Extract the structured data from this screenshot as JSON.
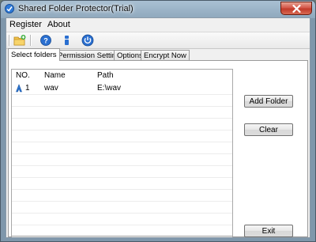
{
  "window": {
    "title": "Shared Folder Protector(Trial)"
  },
  "menu": [
    {
      "label": "Register"
    },
    {
      "label": "About"
    }
  ],
  "toolbar": {
    "icons": [
      "folder-add-icon",
      "help-icon",
      "info-icon",
      "power-icon"
    ]
  },
  "tabs": [
    {
      "label": "Select folders",
      "active": true
    },
    {
      "label": "Permission Settings",
      "active": false
    },
    {
      "label": "Options",
      "active": false
    },
    {
      "label": "Encrypt Now",
      "active": false
    }
  ],
  "table": {
    "columns": [
      "NO.",
      "Name",
      "Path"
    ],
    "rows": [
      {
        "no": "1",
        "name": "wav",
        "path": "E:\\wav"
      }
    ]
  },
  "buttons": {
    "add_folder": "Add Folder",
    "clear": "Clear",
    "exit": "Exit"
  },
  "colors": {
    "titlebar": "#8fa8bd",
    "close": "#c23a2a",
    "accent": "#1e6bd6"
  }
}
